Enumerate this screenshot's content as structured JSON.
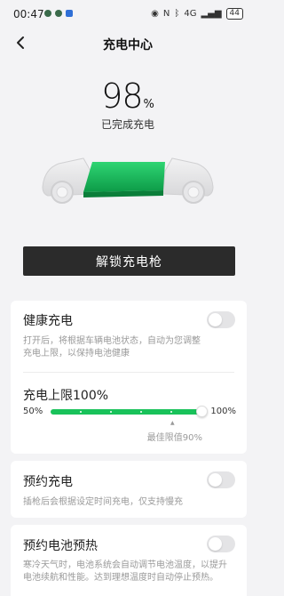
{
  "status_bar": {
    "time": "00:47",
    "battery": "44",
    "network": "4G"
  },
  "header": {
    "title": "充电中心",
    "back_icon": "chevron-left-icon"
  },
  "charge": {
    "percent": "98",
    "percent_sign": "%",
    "status": "已完成充电",
    "level": 0.98
  },
  "unlock_button": {
    "label": "解锁充电枪"
  },
  "healthy_charging": {
    "title": "健康充电",
    "description": "打开后，将根据车辆电池状态，自动为您调整充电上限，以保持电池健康",
    "enabled": false
  },
  "charge_limit": {
    "title": "充电上限100%",
    "min_label": "50%",
    "max_label": "100%",
    "value": 100,
    "min": 50,
    "max": 100,
    "optimal_label": "最佳限值90%",
    "optimal_value": 90
  },
  "scheduled_charging": {
    "title": "预约充电",
    "description": "插枪后会根据设定时间充电，仅支持慢充",
    "enabled": false
  },
  "battery_preheat": {
    "title": "预约电池预热",
    "description": "寒冷天气时，电池系统会自动调节电池温度，以提升电池续航和性能。达到理想温度时自动停止预热。",
    "enabled": false
  },
  "colors": {
    "accent": "#19c25a",
    "button_bg": "#2b2b2b",
    "page_bg": "#f3f3f5"
  }
}
